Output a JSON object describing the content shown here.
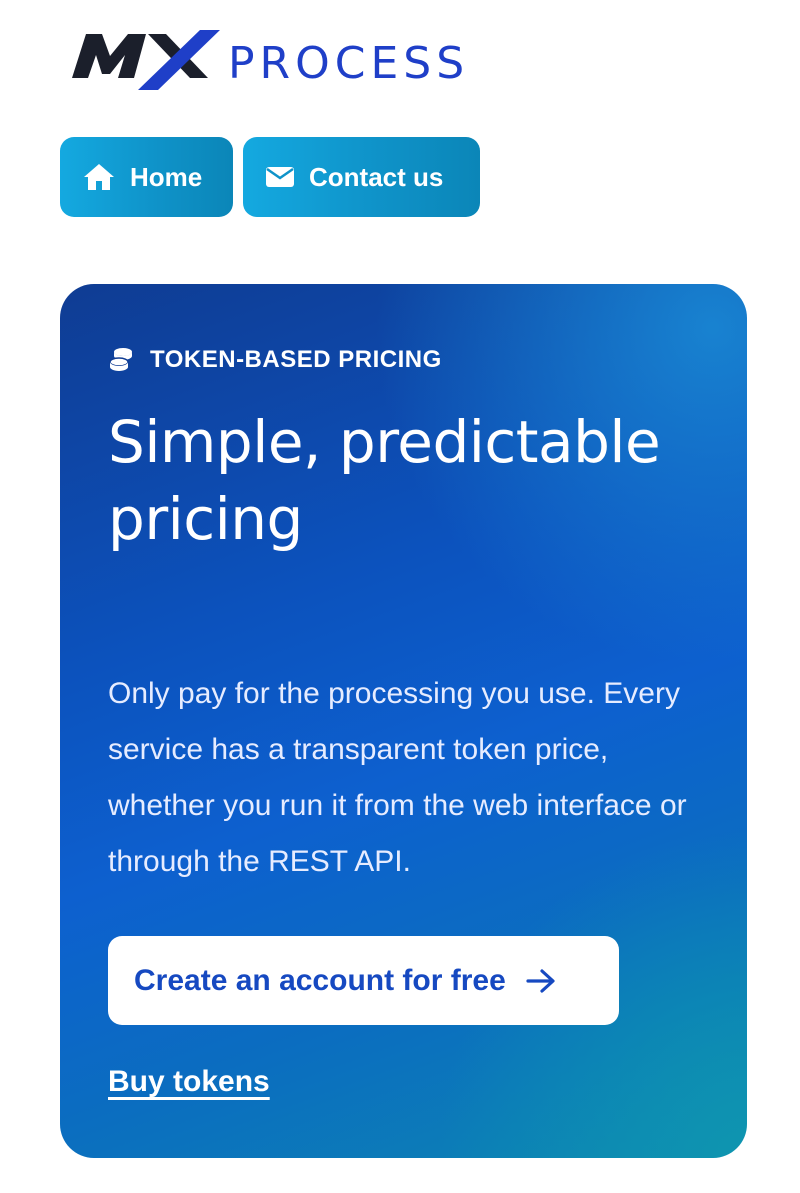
{
  "logo": {
    "mark_text": "MX",
    "word_text": "PROCESS",
    "colors": {
      "dark": "#1b1f2b",
      "blue": "#1f3fc8"
    }
  },
  "nav": {
    "items": [
      {
        "label": "Home",
        "icon": "home-icon"
      },
      {
        "label": "Contact us",
        "icon": "envelope-icon"
      }
    ],
    "color": "#14a9e0"
  },
  "hero": {
    "eyebrow": "TOKEN-BASED PRICING",
    "eyebrow_icon": "coins-icon",
    "headline": "Simple, predictable pricing",
    "description": "Only pay for the processing you use. Every service has a transparent token price, whether you run it from the web interface or through the REST API.",
    "cta_label": "Create an account for free",
    "cta_icon": "arrow-right-icon",
    "secondary_link": "Buy tokens",
    "colors": {
      "card_start": "#0f3c93",
      "card_end": "#0c86b2",
      "cta_text": "#1649c1"
    }
  }
}
